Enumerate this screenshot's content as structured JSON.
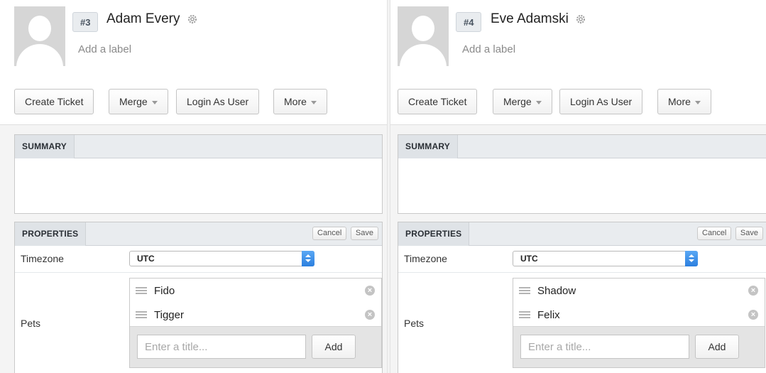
{
  "users": [
    {
      "id": "#3",
      "name": "Adam Every",
      "add_label": "Add a label",
      "actions": {
        "create_ticket": "Create Ticket",
        "merge": "Merge",
        "login_as_user": "Login As User",
        "more": "More"
      },
      "summary": {
        "title": "SUMMARY"
      },
      "properties": {
        "title": "PROPERTIES",
        "cancel_label": "Cancel",
        "save_label": "Save",
        "timezone_label": "Timezone",
        "timezone_value": "UTC",
        "pets_label": "Pets",
        "pets": [
          "Fido",
          "Tigger"
        ],
        "pet_placeholder": "Enter a title...",
        "add_label": "Add"
      }
    },
    {
      "id": "#4",
      "name": "Eve Adamski",
      "add_label": "Add a label",
      "actions": {
        "create_ticket": "Create Ticket",
        "merge": "Merge",
        "login_as_user": "Login As User",
        "more": "More"
      },
      "summary": {
        "title": "SUMMARY"
      },
      "properties": {
        "title": "PROPERTIES",
        "cancel_label": "Cancel",
        "save_label": "Save",
        "timezone_label": "Timezone",
        "timezone_value": "UTC",
        "pets_label": "Pets",
        "pets": [
          "Shadow",
          "Felix"
        ],
        "pet_placeholder": "Enter a title...",
        "add_label": "Add"
      }
    }
  ],
  "icons": {
    "settings": "gear-icon",
    "remove": "remove-circle-icon",
    "drag": "drag-handle-icon",
    "dropdown": "select-arrows-icon"
  }
}
